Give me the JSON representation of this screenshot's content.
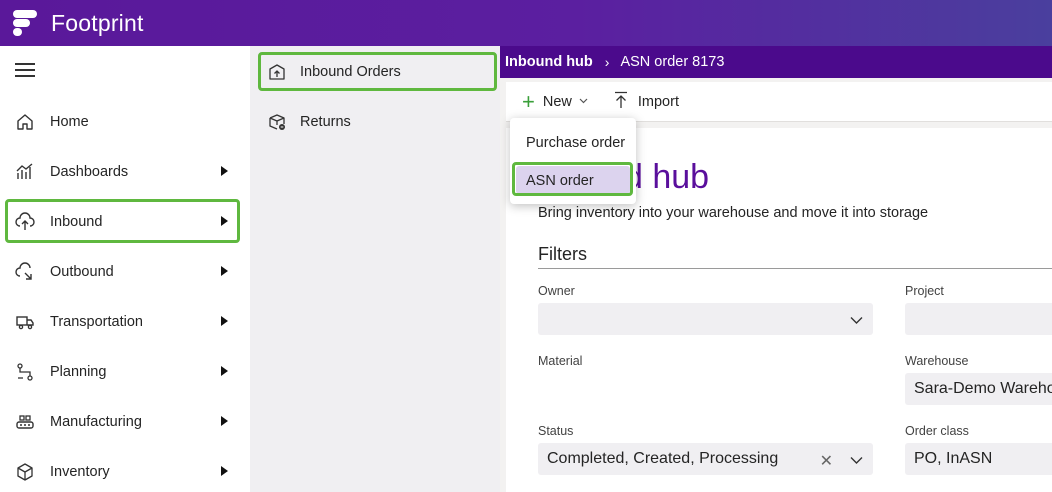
{
  "app": {
    "brand": "Footprint"
  },
  "left_nav": {
    "items": [
      {
        "label": "Home",
        "icon": "home-icon",
        "has_submenu": false
      },
      {
        "label": "Dashboards",
        "icon": "dashboard-chart-icon",
        "has_submenu": true
      },
      {
        "label": "Inbound",
        "icon": "inbound-upload-icon",
        "has_submenu": true
      },
      {
        "label": "Outbound",
        "icon": "outbound-icon",
        "has_submenu": true
      },
      {
        "label": "Transportation",
        "icon": "truck-icon",
        "has_submenu": true
      },
      {
        "label": "Planning",
        "icon": "planning-flow-icon",
        "has_submenu": true
      },
      {
        "label": "Manufacturing",
        "icon": "factory-icon",
        "has_submenu": true
      },
      {
        "label": "Inventory",
        "icon": "box-icon",
        "has_submenu": true
      }
    ]
  },
  "sub_nav": {
    "items": [
      {
        "label": "Inbound Orders",
        "icon": "inbound-orders-icon"
      },
      {
        "label": "Returns",
        "icon": "returns-icon"
      }
    ]
  },
  "breadcrumb": {
    "parent": "Inbound hub",
    "separator": "›",
    "current": "ASN order 8173"
  },
  "toolbar": {
    "new_label": "New",
    "import_label": "Import"
  },
  "new_menu": {
    "items": [
      "Purchase order",
      "ASN order"
    ],
    "highlighted": "ASN order"
  },
  "hub": {
    "title_visible": "d hub",
    "subtitle": "Bring inventory into your warehouse and move it into storage"
  },
  "filters": {
    "heading": "Filters",
    "owner": {
      "label": "Owner",
      "value": ""
    },
    "project": {
      "label": "Project",
      "value": ""
    },
    "material": {
      "label": "Material",
      "value": ""
    },
    "warehouse": {
      "label": "Warehouse",
      "value": "Sara-Demo Wareho"
    },
    "status": {
      "label": "Status",
      "value": "Completed, Created, Processing"
    },
    "order_class": {
      "label": "Order class",
      "value": "PO, InASN"
    }
  },
  "colors": {
    "accent_purple": "#5a0f9c",
    "breadcrumb_bg": "#4b0a8c",
    "highlight_green": "#5fb83f",
    "menu_selected": "#dcd3ee"
  }
}
